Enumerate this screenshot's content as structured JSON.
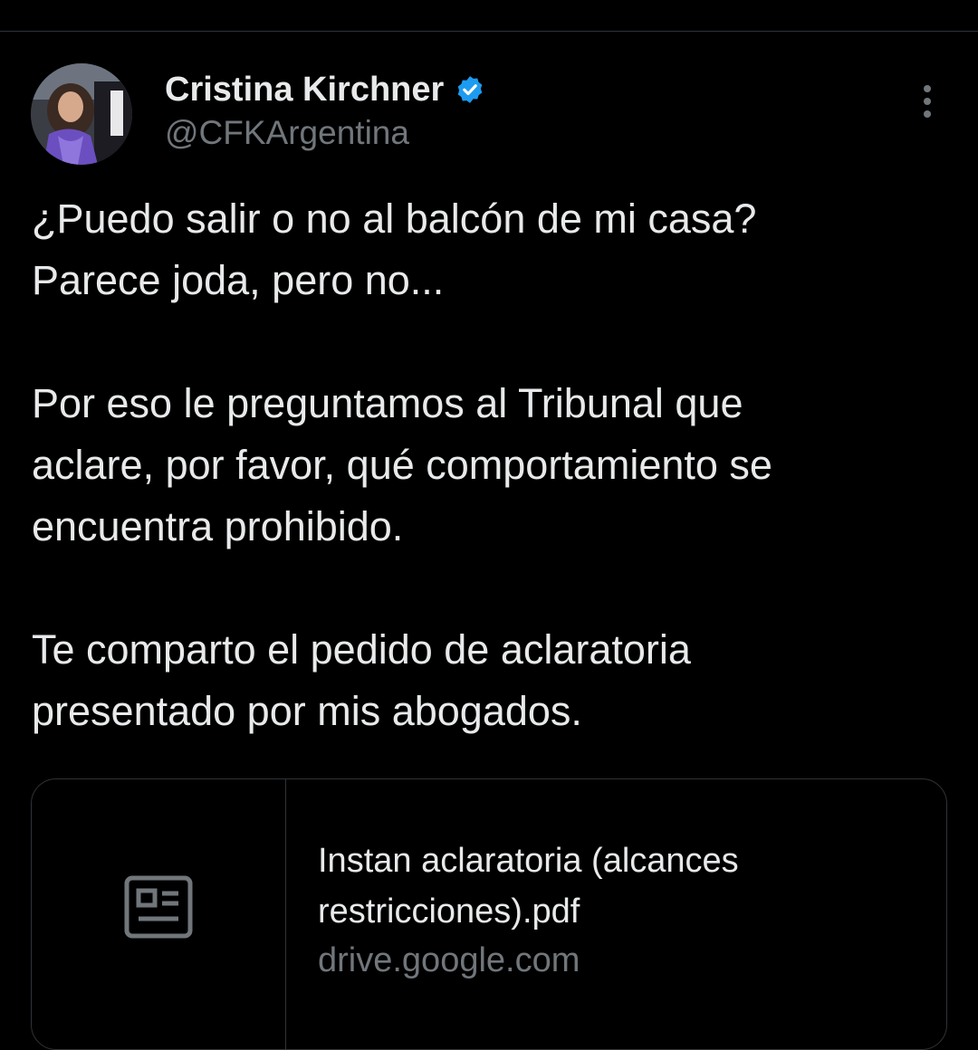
{
  "author": {
    "display_name": "Cristina Kirchner",
    "handle": "@CFKArgentina",
    "verified_icon": "verified-badge-icon",
    "verified_color": "#1d9bf0"
  },
  "menu": {
    "icon": "more-options-icon"
  },
  "tweet": {
    "lines": [
      "¿Puedo salir o no al balcón de mi casa?",
      "Parece joda, pero no...",
      "",
      "Por eso le preguntamos al Tribunal que",
      "aclare, por favor, qué comportamiento se",
      "encuentra prohibido.",
      "",
      "Te comparto el pedido de aclaratoria",
      "presentado por mis abogados."
    ]
  },
  "link_card": {
    "icon": "article-icon",
    "title_lines": [
      "Instan aclaratoria (alcances",
      "restricciones).pdf"
    ],
    "domain": "drive.google.com"
  },
  "colors": {
    "background": "#000000",
    "text_primary": "#e7e9ea",
    "text_secondary": "#71767b",
    "border": "#2f3336"
  }
}
